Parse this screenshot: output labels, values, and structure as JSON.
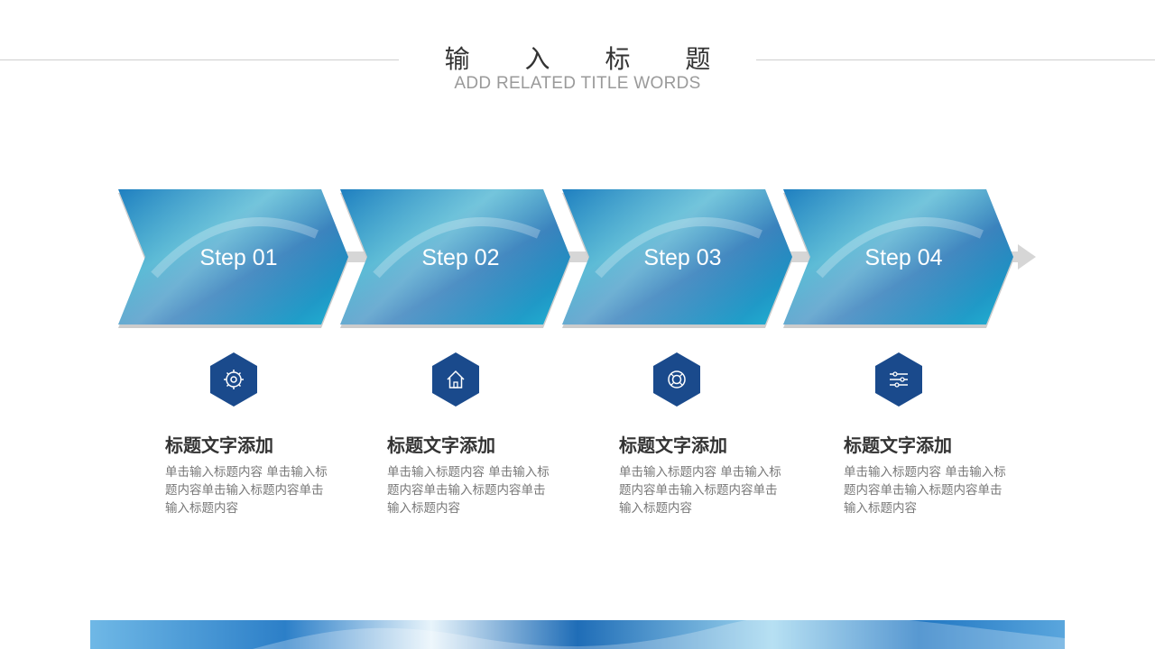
{
  "header": {
    "title": "输 入 标 题",
    "subtitle": "ADD RELATED TITLE WORDS"
  },
  "colors": {
    "accent_dark": "#1a4a8c",
    "accent_light": "#2aa6c9",
    "connector": "#d6d6d6"
  },
  "steps": [
    {
      "label": "Step 01",
      "icon": "gear-icon",
      "title": "标题文字添加",
      "body": "单击输入标题内容 单击输入标题内容单击输入标题内容单击输入标题内容"
    },
    {
      "label": "Step 02",
      "icon": "home-icon",
      "title": "标题文字添加",
      "body": "单击输入标题内容 单击输入标题内容单击输入标题内容单击输入标题内容"
    },
    {
      "label": "Step 03",
      "icon": "lifebuoy-icon",
      "title": "标题文字添加",
      "body": "单击输入标题内容 单击输入标题内容单击输入标题内容单击输入标题内容"
    },
    {
      "label": "Step 04",
      "icon": "sliders-icon",
      "title": "标题文字添加",
      "body": "单击输入标题内容 单击输入标题内容单击输入标题内容单击输入标题内容"
    }
  ]
}
